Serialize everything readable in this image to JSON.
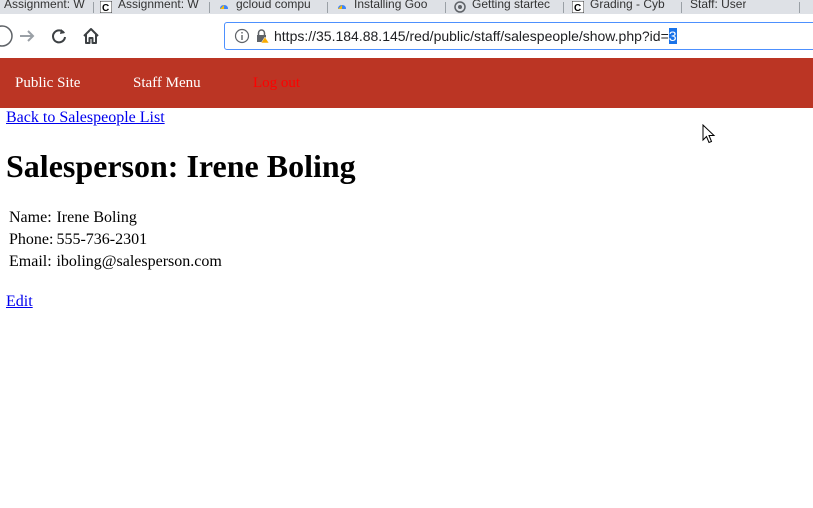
{
  "browser": {
    "tabs": [
      {
        "title": "Assignment: W",
        "favicon": "doc-icon"
      },
      {
        "title": "Assignment: W",
        "favicon": "codepath-icon"
      },
      {
        "title": "gcloud compu",
        "favicon": "gcloud-icon"
      },
      {
        "title": "Installing Goo",
        "favicon": "gcloud-icon"
      },
      {
        "title": "Getting startec",
        "favicon": "gear-icon"
      },
      {
        "title": "Grading - Cyb",
        "favicon": "codepath-icon"
      },
      {
        "title": "Staff: User",
        "favicon": ""
      }
    ],
    "url_main": "https://35.184.88.145/red/public/staff/salespeople/show.php?id=",
    "url_selected": "3"
  },
  "nav": {
    "public_site": "Public Site",
    "staff_menu": "Staff Menu",
    "log_out": "Log out",
    "bar_color": "#bb3524",
    "logout_color": "#ff0000"
  },
  "page": {
    "back_link": "Back to Salespeople List",
    "heading": "Salesperson: Irene Boling",
    "details": [
      {
        "label": "Name:",
        "value": "Irene Boling"
      },
      {
        "label": "Phone:",
        "value": "555-736-2301"
      },
      {
        "label": "Email:",
        "value": "iboling@salesperson.com"
      }
    ],
    "edit_link": "Edit"
  }
}
